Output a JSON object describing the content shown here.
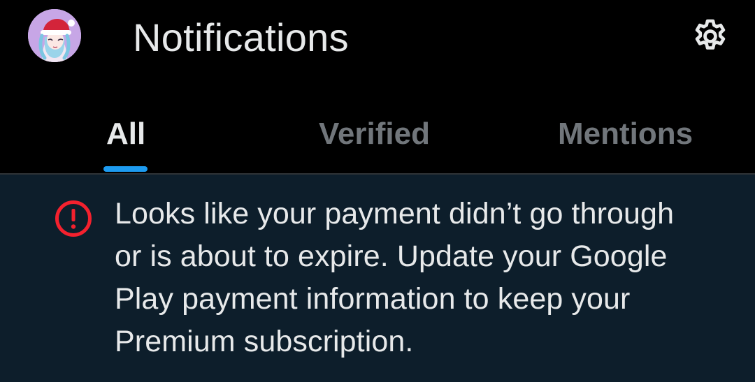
{
  "header": {
    "title": "Notifications",
    "avatar_icon": "profile-avatar",
    "settings_icon": "gear-icon"
  },
  "tabs": [
    {
      "label": "All",
      "selected": true
    },
    {
      "label": "Verified",
      "selected": false
    },
    {
      "label": "Mentions",
      "selected": false
    }
  ],
  "banner": {
    "icon": "alert-circle-icon",
    "message_lines": [
      "Looks like your payment didn’t go through",
      "or is about to expire. Update your Google",
      "Play payment information to keep your",
      "Premium subscription."
    ]
  },
  "colors": {
    "background": "#000000",
    "banner_background": "#0d1e2b",
    "accent": "#1d9bf0",
    "alert": "#f4212e",
    "text_primary": "#e7e9ea",
    "text_secondary": "#71767b"
  }
}
